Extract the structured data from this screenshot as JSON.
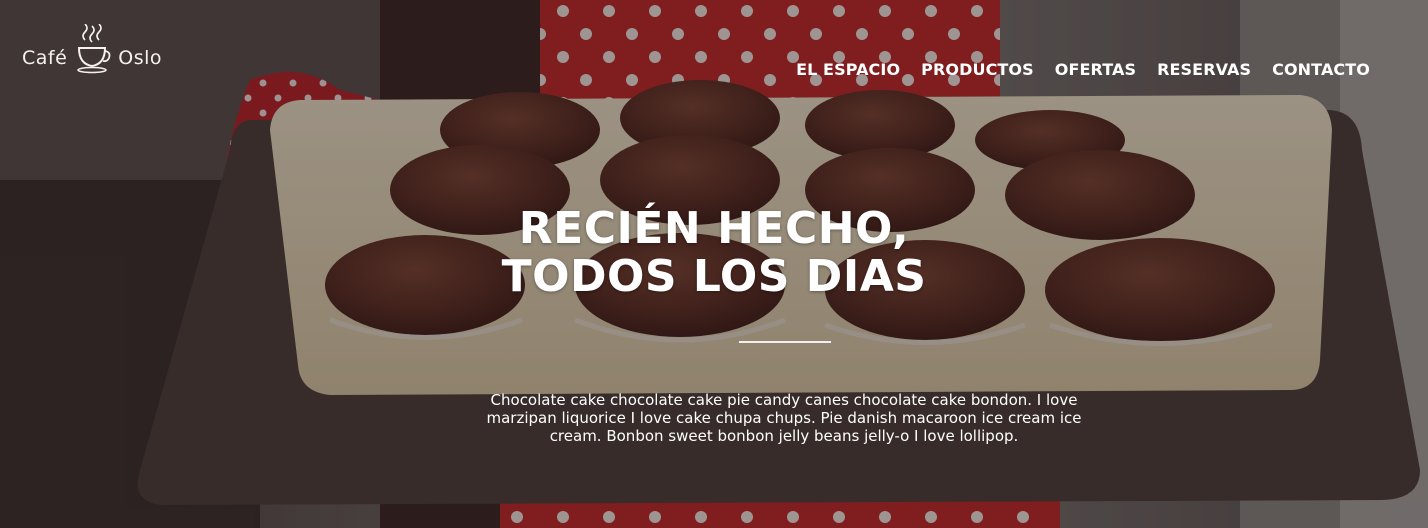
{
  "brand": {
    "word1": "Café",
    "word2": "Oslo",
    "logo_icon": "steaming-cup-icon"
  },
  "nav": {
    "items": [
      "EL ESPACIO",
      "PRODUCTOS",
      "OFERTAS",
      "RESERVAS",
      "CONTACTO"
    ]
  },
  "hero": {
    "title_line1": "RECIÉN HECHO,",
    "title_line2": "TODOS LOS DIAS",
    "description": "Chocolate cake chocolate cake pie candy canes chocolate cake bondon. I love marzipan liquorice I love cake chupa chups. Pie danish macaroon ice cream ice cream. Bonbon sweet bonbon jelly beans jelly-o I love lollipop."
  },
  "colors": {
    "apron_red": "#c8262a",
    "muffin_brown": "#5a2f26",
    "tray_cream": "#e9dcc0",
    "text_white": "#ffffff"
  }
}
